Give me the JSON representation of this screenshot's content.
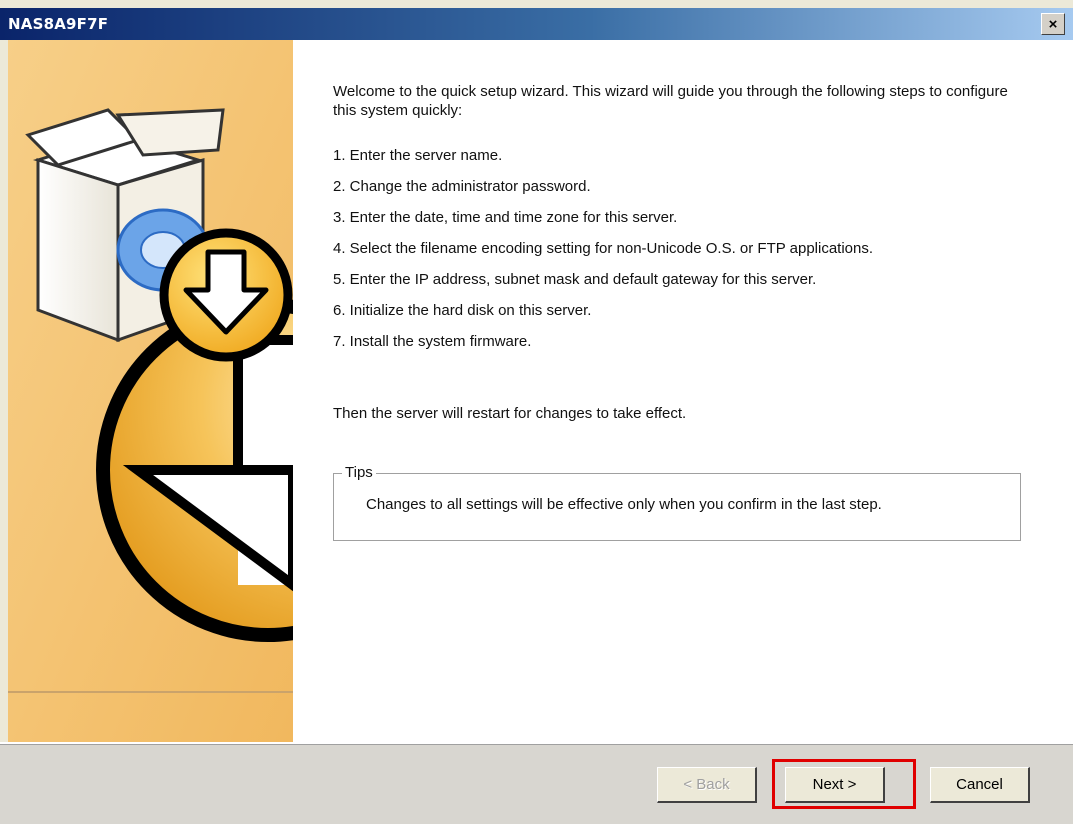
{
  "window": {
    "title": "NAS8A9F7F",
    "close_label": "×"
  },
  "content": {
    "intro": "Welcome to the quick setup wizard. This wizard will guide you through the following steps to configure this system quickly:",
    "steps": [
      "1. Enter the server name.",
      "2. Change the administrator password.",
      "3. Enter the date, time and time zone for this server.",
      "4. Select the filename encoding setting for non-Unicode O.S. or FTP applications.",
      "5. Enter the IP address, subnet mask and default gateway for this server.",
      "6. Initialize the hard disk on this server.",
      "7. Install the system firmware."
    ],
    "outro": "Then the server will restart for changes to take effect.",
    "tips": {
      "legend": "Tips",
      "text": "Changes to all settings will be effective only when you confirm in the last step."
    }
  },
  "footer": {
    "back_label": "< Back",
    "back_enabled": false,
    "next_label": "Next >",
    "cancel_label": "Cancel",
    "highlight_color": "#e00000"
  },
  "icons": {
    "side_graphic": "software-box-download-icon"
  },
  "colors": {
    "side_panel": "#f5c579",
    "title_bar": "#0a246a",
    "circle_fill": "#f2b640"
  }
}
